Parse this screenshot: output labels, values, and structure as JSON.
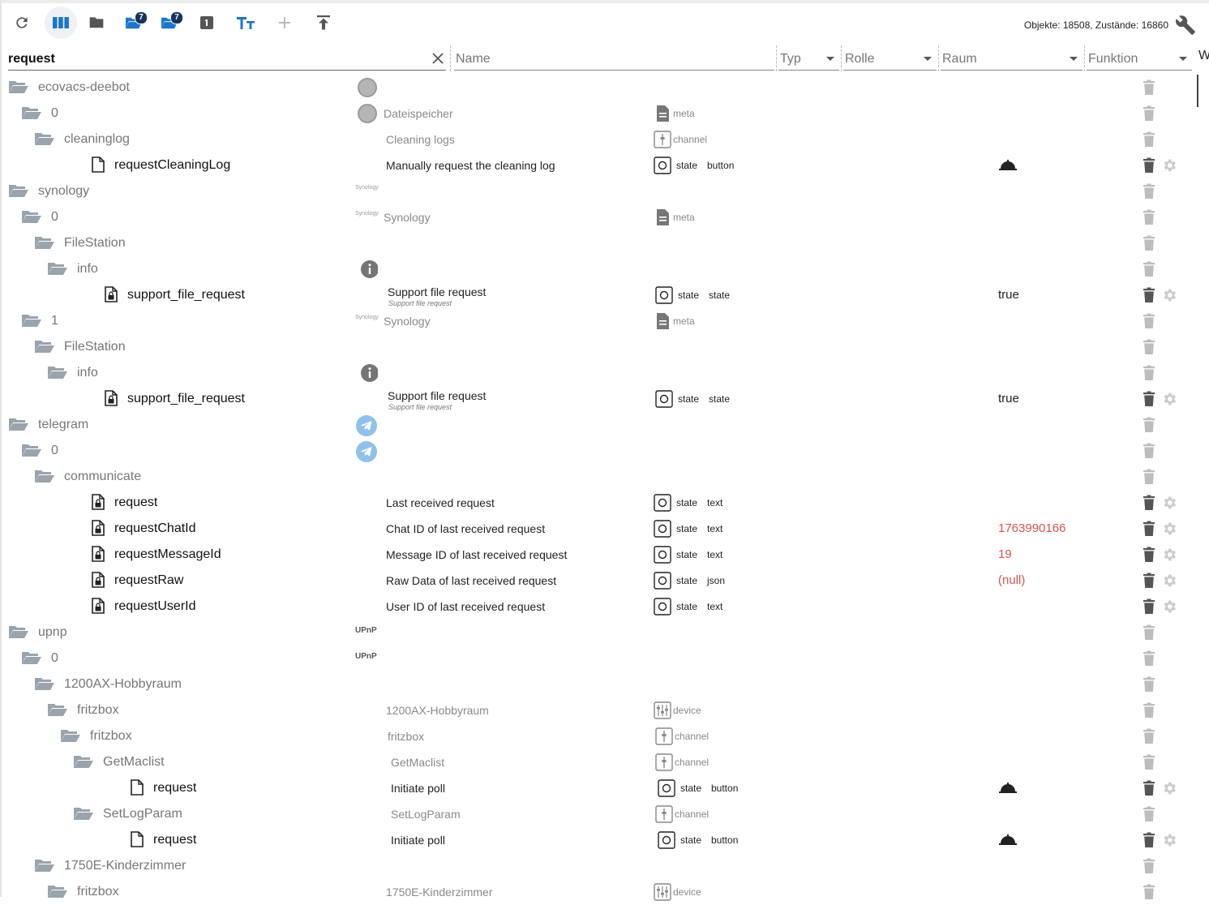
{
  "toolbar": {
    "buttons": [
      {
        "name": "refresh-button",
        "icon": "refresh-icon",
        "badge": ""
      },
      {
        "name": "columns-button",
        "icon": "columns-icon",
        "badge": ""
      },
      {
        "name": "folder-button",
        "icon": "folder-icon",
        "badge": ""
      },
      {
        "name": "folder-open-badge-button",
        "icon": "folder-open-icon",
        "badge": "7"
      },
      {
        "name": "folder-closed-badge-button",
        "icon": "folder-badge-icon",
        "badge": "7"
      },
      {
        "name": "one-button",
        "icon": "number-one-icon",
        "badge": ""
      },
      {
        "name": "text-size-button",
        "icon": "text-size-icon",
        "badge": ""
      },
      {
        "name": "add-button",
        "icon": "plus-icon",
        "badge": ""
      },
      {
        "name": "upload-button",
        "icon": "upload-icon",
        "badge": ""
      }
    ],
    "counts": "Objekte: 18508, Zustände: 16860"
  },
  "filters": {
    "search_value": "request",
    "name_placeholder": "Name",
    "typ_placeholder": "Typ",
    "rolle_placeholder": "Rolle",
    "raum_placeholder": "Raum",
    "funktion_placeholder": "Funktion",
    "cut_column": "W"
  },
  "rows": [
    {
      "id": "ecovacs-deebot",
      "level": 0,
      "kind": "folder",
      "adapter_icon": "ecovacs-icon",
      "name": "",
      "subname": "",
      "type_icon": "",
      "type": "",
      "role": "",
      "value": "",
      "value_color": "",
      "bell": false,
      "gear": false
    },
    {
      "id": "0",
      "level": 1,
      "kind": "folder",
      "adapter_icon": "ecovacs-icon",
      "name": "Dateispeicher",
      "subname": "",
      "type_icon": "meta",
      "type": "meta",
      "role": "",
      "value": "",
      "value_color": "",
      "bell": false,
      "gear": false
    },
    {
      "id": "cleaninglog",
      "level": 2,
      "kind": "folder",
      "adapter_icon": "",
      "name": "Cleaning logs",
      "subname": "",
      "type_icon": "channel",
      "type": "channel",
      "role": "",
      "value": "",
      "value_color": "",
      "bell": false,
      "gear": false
    },
    {
      "id": "requestCleaningLog",
      "level": 3,
      "kind": "state",
      "lock": false,
      "adapter_icon": "",
      "name": "Manually request the cleaning log",
      "subname": "",
      "type_icon": "state",
      "type": "state",
      "role": "button",
      "value": "",
      "value_color": "",
      "bell": true,
      "gear": true
    },
    {
      "id": "synology",
      "level": 0,
      "kind": "folder",
      "adapter_icon": "synology-icon",
      "name": "",
      "subname": "",
      "type_icon": "",
      "type": "",
      "role": "",
      "value": "",
      "value_color": "",
      "bell": false,
      "gear": false
    },
    {
      "id": "0",
      "level": 1,
      "kind": "folder",
      "adapter_icon": "synology-icon",
      "name": "Synology",
      "subname": "",
      "type_icon": "meta",
      "type": "meta",
      "role": "",
      "value": "",
      "value_color": "",
      "bell": false,
      "gear": false
    },
    {
      "id": "FileStation",
      "level": 2,
      "kind": "folder",
      "adapter_icon": "",
      "name": "",
      "subname": "",
      "type_icon": "",
      "type": "",
      "role": "",
      "value": "",
      "value_color": "",
      "bell": false,
      "gear": false
    },
    {
      "id": "info",
      "level": 3,
      "kind": "folder",
      "adapter_icon": "info-icon",
      "name": "",
      "subname": "",
      "type_icon": "",
      "type": "",
      "role": "",
      "value": "",
      "value_color": "",
      "bell": false,
      "gear": false
    },
    {
      "id": "support_file_request",
      "level": 4,
      "kind": "state",
      "lock": true,
      "adapter_icon": "",
      "name": "Support file request",
      "subname": "Support file request",
      "type_icon": "state",
      "type": "state",
      "role": "state",
      "value": "true",
      "value_color": "black",
      "bell": false,
      "gear": true
    },
    {
      "id": "1",
      "level": 1,
      "kind": "folder",
      "adapter_icon": "synology-icon",
      "name": "Synology",
      "subname": "",
      "type_icon": "meta",
      "type": "meta",
      "role": "",
      "value": "",
      "value_color": "",
      "bell": false,
      "gear": false
    },
    {
      "id": "FileStation",
      "level": 2,
      "kind": "folder",
      "adapter_icon": "",
      "name": "",
      "subname": "",
      "type_icon": "",
      "type": "",
      "role": "",
      "value": "",
      "value_color": "",
      "bell": false,
      "gear": false
    },
    {
      "id": "info",
      "level": 3,
      "kind": "folder",
      "adapter_icon": "info-icon",
      "name": "",
      "subname": "",
      "type_icon": "",
      "type": "",
      "role": "",
      "value": "",
      "value_color": "",
      "bell": false,
      "gear": false
    },
    {
      "id": "support_file_request",
      "level": 4,
      "kind": "state",
      "lock": true,
      "adapter_icon": "",
      "name": "Support file request",
      "subname": "Support file request",
      "type_icon": "state",
      "type": "state",
      "role": "state",
      "value": "true",
      "value_color": "black",
      "bell": false,
      "gear": true
    },
    {
      "id": "telegram",
      "level": 0,
      "kind": "folder",
      "adapter_icon": "telegram-icon",
      "name": "",
      "subname": "",
      "type_icon": "",
      "type": "",
      "role": "",
      "value": "",
      "value_color": "",
      "bell": false,
      "gear": false
    },
    {
      "id": "0",
      "level": 1,
      "kind": "folder",
      "adapter_icon": "telegram-icon",
      "name": "",
      "subname": "",
      "type_icon": "",
      "type": "",
      "role": "",
      "value": "",
      "value_color": "",
      "bell": false,
      "gear": false
    },
    {
      "id": "communicate",
      "level": 2,
      "kind": "folder",
      "adapter_icon": "",
      "name": "",
      "subname": "",
      "type_icon": "",
      "type": "",
      "role": "",
      "value": "",
      "value_color": "",
      "bell": false,
      "gear": false
    },
    {
      "id": "request",
      "level": 3,
      "kind": "state",
      "lock": true,
      "adapter_icon": "",
      "name": "Last received request",
      "subname": "",
      "type_icon": "state",
      "type": "state",
      "role": "text",
      "value": "",
      "value_color": "",
      "bell": false,
      "gear": true
    },
    {
      "id": "requestChatId",
      "level": 3,
      "kind": "state",
      "lock": true,
      "adapter_icon": "",
      "name": "Chat ID of last received request",
      "subname": "",
      "type_icon": "state",
      "type": "state",
      "role": "text",
      "value": "1763990166",
      "value_color": "red",
      "bell": false,
      "gear": true
    },
    {
      "id": "requestMessageId",
      "level": 3,
      "kind": "state",
      "lock": true,
      "adapter_icon": "",
      "name": "Message ID of last received request",
      "subname": "",
      "type_icon": "state",
      "type": "state",
      "role": "text",
      "value": "19",
      "value_color": "red",
      "bell": false,
      "gear": true
    },
    {
      "id": "requestRaw",
      "level": 3,
      "kind": "state",
      "lock": true,
      "adapter_icon": "",
      "name": "Raw Data of last received request",
      "subname": "",
      "type_icon": "state",
      "type": "state",
      "role": "json",
      "value": "(null)",
      "value_color": "red",
      "bell": false,
      "gear": true
    },
    {
      "id": "requestUserId",
      "level": 3,
      "kind": "state",
      "lock": true,
      "adapter_icon": "",
      "name": "User ID of last received request",
      "subname": "",
      "type_icon": "state",
      "type": "state",
      "role": "text",
      "value": "",
      "value_color": "",
      "bell": false,
      "gear": true
    },
    {
      "id": "upnp",
      "level": 0,
      "kind": "folder",
      "adapter_icon": "upnp-icon",
      "name": "",
      "subname": "",
      "type_icon": "",
      "type": "",
      "role": "",
      "value": "",
      "value_color": "",
      "bell": false,
      "gear": false
    },
    {
      "id": "0",
      "level": 1,
      "kind": "folder",
      "adapter_icon": "upnp-icon",
      "name": "",
      "subname": "",
      "type_icon": "",
      "type": "",
      "role": "",
      "value": "",
      "value_color": "",
      "bell": false,
      "gear": false
    },
    {
      "id": "1200AX-Hobbyraum",
      "level": 2,
      "kind": "folder",
      "adapter_icon": "",
      "name": "",
      "subname": "",
      "type_icon": "",
      "type": "",
      "role": "",
      "value": "",
      "value_color": "",
      "bell": false,
      "gear": false
    },
    {
      "id": "fritzbox",
      "level": 3,
      "kind": "folder",
      "adapter_icon": "",
      "name": "1200AX-Hobbyraum",
      "subname": "",
      "type_icon": "device",
      "type": "device",
      "role": "",
      "value": "",
      "value_color": "",
      "bell": false,
      "gear": false
    },
    {
      "id": "fritzbox",
      "level": 4,
      "kind": "folder",
      "adapter_icon": "",
      "name": "fritzbox",
      "subname": "",
      "type_icon": "channel",
      "type": "channel",
      "role": "",
      "value": "",
      "value_color": "",
      "bell": false,
      "gear": false
    },
    {
      "id": "GetMaclist",
      "level": 5,
      "kind": "folder",
      "adapter_icon": "",
      "name": "GetMaclist",
      "subname": "",
      "type_icon": "channel",
      "type": "channel",
      "role": "",
      "value": "",
      "value_color": "",
      "bell": false,
      "gear": false
    },
    {
      "id": "request",
      "level": 6,
      "kind": "state",
      "lock": false,
      "adapter_icon": "",
      "name": "Initiate poll",
      "subname": "",
      "type_icon": "state",
      "type": "state",
      "role": "button",
      "value": "",
      "value_color": "",
      "bell": true,
      "gear": true
    },
    {
      "id": "SetLogParam",
      "level": 5,
      "kind": "folder",
      "adapter_icon": "",
      "name": "SetLogParam",
      "subname": "",
      "type_icon": "channel",
      "type": "channel",
      "role": "",
      "value": "",
      "value_color": "",
      "bell": false,
      "gear": false
    },
    {
      "id": "request",
      "level": 6,
      "kind": "state",
      "lock": false,
      "adapter_icon": "",
      "name": "Initiate poll",
      "subname": "",
      "type_icon": "state",
      "type": "state",
      "role": "button",
      "value": "",
      "value_color": "",
      "bell": true,
      "gear": true
    },
    {
      "id": "1750E-Kinderzimmer",
      "level": 2,
      "kind": "folder",
      "adapter_icon": "",
      "name": "",
      "subname": "",
      "type_icon": "",
      "type": "",
      "role": "",
      "value": "",
      "value_color": "",
      "bell": false,
      "gear": false
    },
    {
      "id": "fritzbox",
      "level": 3,
      "kind": "folder",
      "adapter_icon": "",
      "name": "1750E-Kinderzimmer",
      "subname": "",
      "type_icon": "device",
      "type": "device",
      "role": "",
      "value": "",
      "value_color": "",
      "bell": false,
      "gear": false
    }
  ],
  "adapter_labels": {
    "synology": "Synology",
    "upnp": "UPnP"
  },
  "colors": {
    "accent": "#1976d2",
    "badge": "#14345f",
    "value_red": "#d9534f",
    "telegram": "#8ec2ec"
  }
}
